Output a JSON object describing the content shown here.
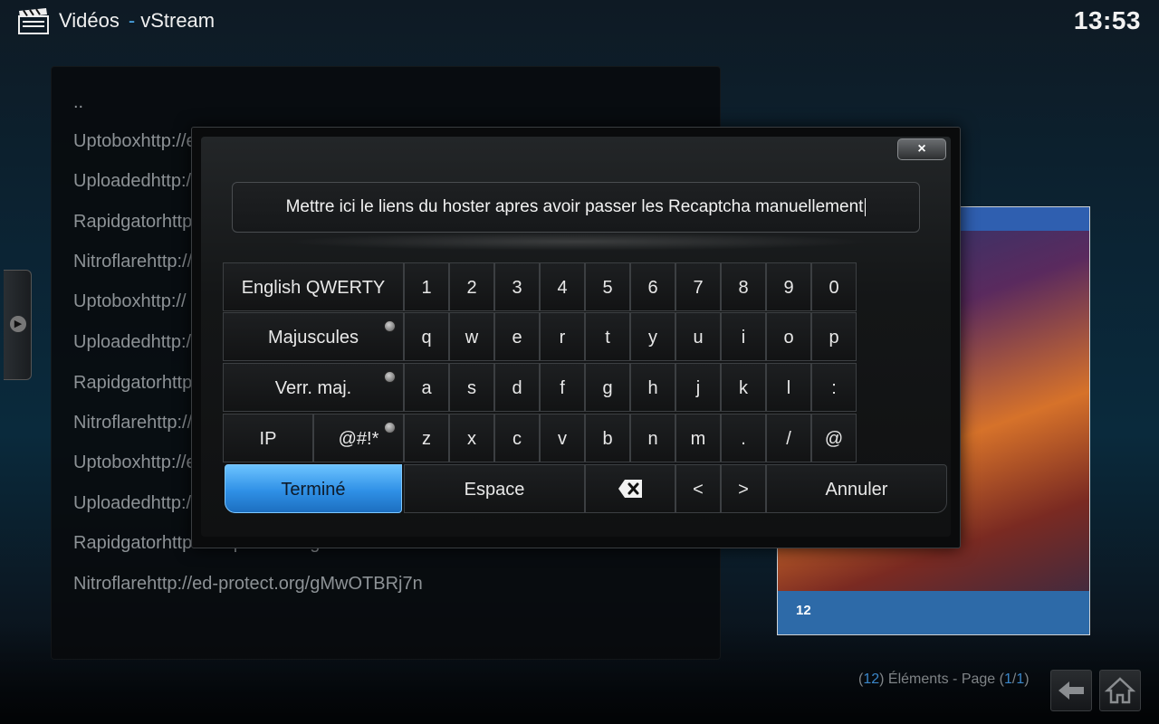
{
  "header": {
    "section": "Vidéos",
    "separator": "-",
    "addon": "vStream",
    "clock": "13:53"
  },
  "list": {
    "items": [
      "..",
      "Uptoboxhttp://e",
      "Uploadedhttp://",
      "Rapidgatorhttp",
      "Nitroflarehttp://",
      "Uptoboxhttp://",
      "Uploadedhttp://",
      "Rapidgatorhttp",
      "Nitroflarehttp://",
      "Uptoboxhttp://e",
      "Uploadedhttp://",
      "Rapidgatorhttp://ed-protect.org/...",
      "Nitroflarehttp://ed-protect.org/gMwOTBRj7n"
    ]
  },
  "dialog": {
    "close_label": "×",
    "input_value": "Mettre ici le liens du hoster apres avoir passer les Recaptcha manuellement",
    "keys": {
      "layout": "English QWERTY",
      "shift": "Majuscules",
      "capslock": "Verr. maj.",
      "ip": "IP",
      "symbols": "@#!*",
      "done": "Terminé",
      "space": "Espace",
      "left": "<",
      "right": ">",
      "cancel": "Annuler",
      "row1": [
        "1",
        "2",
        "3",
        "4",
        "5",
        "6",
        "7",
        "8",
        "9",
        "0"
      ],
      "row2": [
        "q",
        "w",
        "e",
        "r",
        "t",
        "y",
        "u",
        "i",
        "o",
        "p"
      ],
      "row3": [
        "a",
        "s",
        "d",
        "f",
        "g",
        "h",
        "j",
        "k",
        "l",
        ":"
      ],
      "row4": [
        "z",
        "x",
        "c",
        "v",
        "b",
        "n",
        "m",
        ".",
        "/",
        "@"
      ]
    }
  },
  "poster": {
    "age_rating": "12"
  },
  "footer": {
    "count": "12",
    "elements_label": "Éléments - Page",
    "page": "1",
    "pages": "1"
  },
  "colors": {
    "accent": "#3a86c8",
    "done_key": "#2f90e6"
  }
}
